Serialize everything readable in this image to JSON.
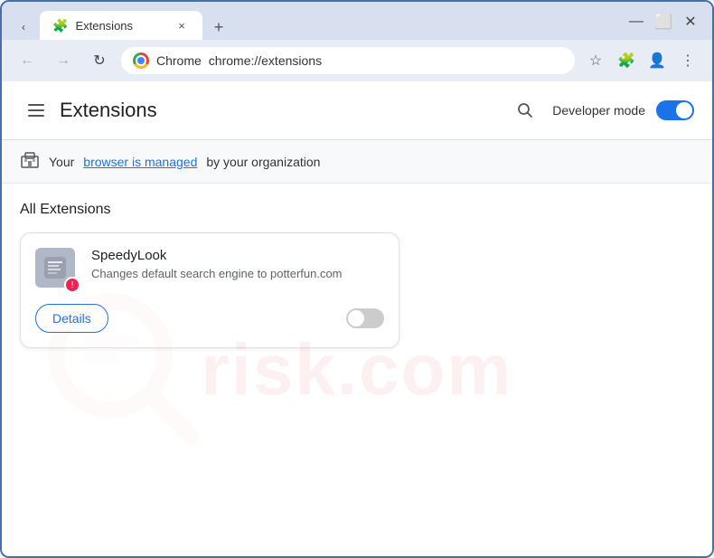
{
  "browser": {
    "tab": {
      "favicon": "🧩",
      "title": "Extensions",
      "close_label": "×"
    },
    "new_tab_label": "+",
    "window_controls": {
      "minimize": "—",
      "maximize": "⬜",
      "close": "✕"
    },
    "nav": {
      "back_label": "←",
      "forward_label": "→",
      "reload_label": "↻"
    },
    "address_bar": {
      "chrome_label": "Chrome",
      "url": "chrome://extensions"
    },
    "address_icons": {
      "star": "☆",
      "extension": "🧩",
      "profile": "👤",
      "menu": "⋮"
    }
  },
  "page": {
    "header": {
      "title": "Extensions",
      "dev_mode_label": "Developer mode",
      "search_title": "Search extensions"
    },
    "managed_banner": {
      "icon": "🏢",
      "prefix": "Your ",
      "link_text": "browser is managed",
      "suffix": " by your organization"
    },
    "extensions_section_label": "All Extensions",
    "extension": {
      "name": "SpeedyLook",
      "description": "Changes default search engine to potterfun.com",
      "details_btn_label": "Details",
      "toggle_state": "off"
    }
  },
  "watermark": {
    "text": "risk.com"
  }
}
